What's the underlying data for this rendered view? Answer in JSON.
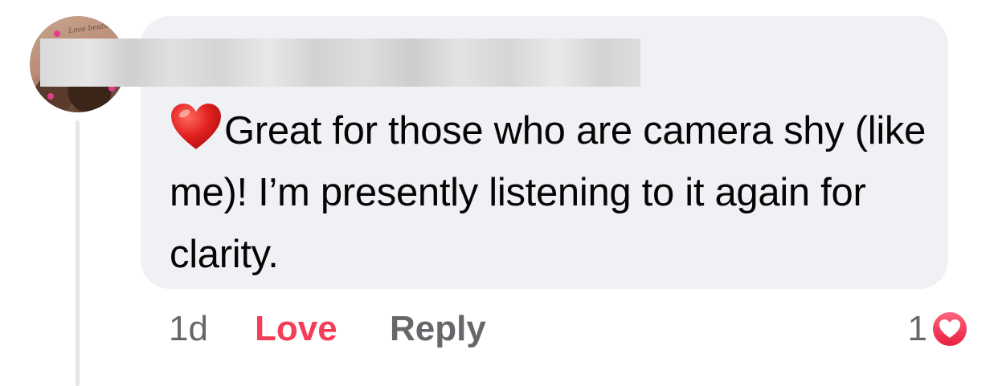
{
  "comment": {
    "author_name": "",
    "text": "Great for those who are camera shy (like me)! I’m presently listening to it again for clarity.",
    "leading_emoji": "red-heart-emoji"
  },
  "actions": {
    "timestamp": "1d",
    "love_label": "Love",
    "reply_label": "Reply"
  },
  "reactions": {
    "count": "1",
    "icon": "love-reaction-icon",
    "icon_color": "#f33e58"
  },
  "colors": {
    "bubble": "#f0f1f4",
    "text": "#050505",
    "muted": "#65676b",
    "love": "#f33e58"
  }
}
